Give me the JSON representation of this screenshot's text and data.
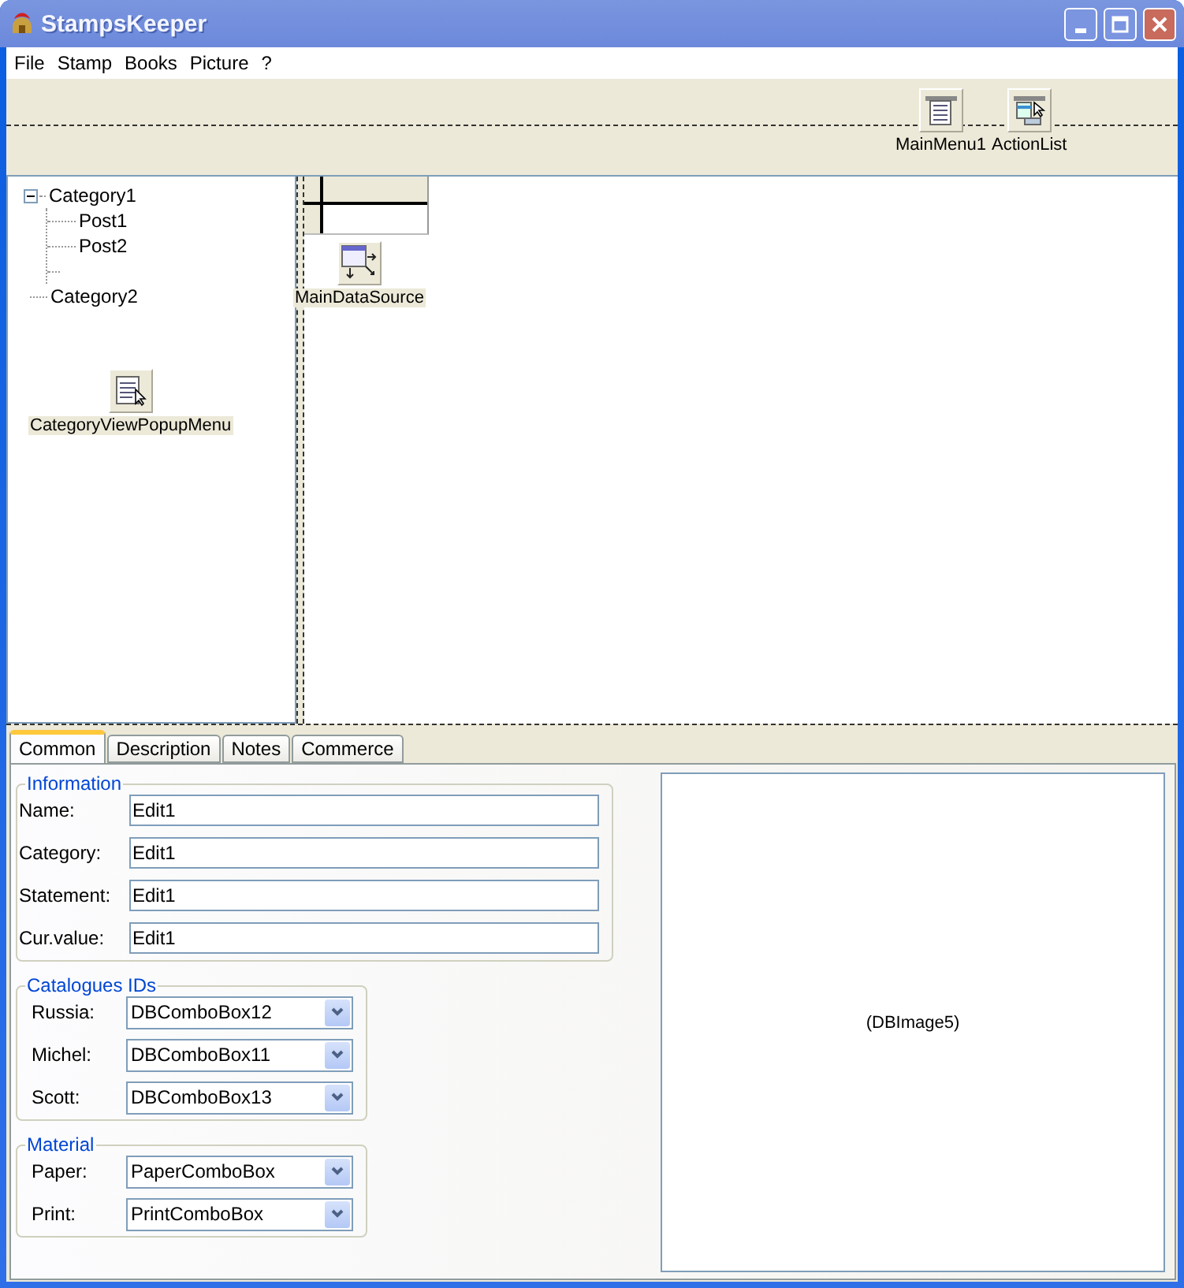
{
  "window": {
    "title": "StampsKeeper"
  },
  "menu": [
    "File",
    "Stamp",
    "Books",
    "Picture",
    "?"
  ],
  "toolbar_components": [
    {
      "label": "MainMenu1",
      "kind": "main-menu"
    },
    {
      "label": "ActionList",
      "kind": "action-list"
    }
  ],
  "tree": [
    {
      "label": "Category1",
      "expanded": true,
      "children": [
        {
          "label": "Post1"
        },
        {
          "label": "Post2"
        }
      ]
    },
    {
      "label": "Category2"
    }
  ],
  "tree_component": {
    "label": "CategoryViewPopupMenu",
    "kind": "popup-menu"
  },
  "data_component": {
    "label": "MainDataSource",
    "kind": "data-source"
  },
  "tabs": [
    {
      "label": "Common",
      "selected": true
    },
    {
      "label": "Description",
      "selected": false
    },
    {
      "label": "Notes",
      "selected": false
    },
    {
      "label": "Commerce",
      "selected": false
    }
  ],
  "groups": [
    {
      "title": "Information",
      "fields": [
        {
          "label": "Name:",
          "value": "Edit1",
          "kind": "edit"
        },
        {
          "label": "Category:",
          "value": "Edit1",
          "kind": "edit"
        },
        {
          "label": "Statement:",
          "value": "Edit1",
          "kind": "edit"
        },
        {
          "label": "Cur.value:",
          "value": "Edit1",
          "kind": "edit"
        }
      ]
    },
    {
      "title": "Catalogues IDs",
      "fields": [
        {
          "label": "Russia:",
          "value": "DBComboBox12",
          "kind": "combo"
        },
        {
          "label": "Michel:",
          "value": "DBComboBox11",
          "kind": "combo"
        },
        {
          "label": "Scott:",
          "value": "DBComboBox13",
          "kind": "combo"
        }
      ]
    },
    {
      "title": "Material",
      "fields": [
        {
          "label": "Paper:",
          "value": "PaperComboBox",
          "kind": "combo"
        },
        {
          "label": "Print:",
          "value": "PrintComboBox",
          "kind": "combo"
        }
      ]
    }
  ],
  "image_box": {
    "caption": "(DBImage5)"
  }
}
